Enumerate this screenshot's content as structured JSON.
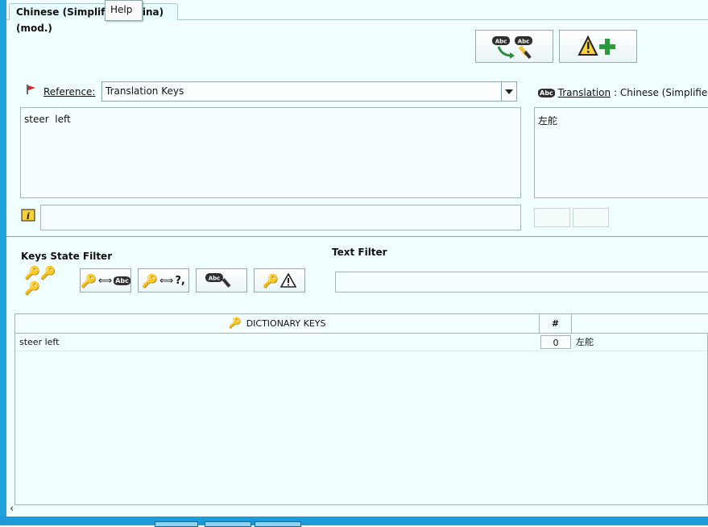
{
  "tabs": {
    "active_tab_label": "Chinese (Simplified, China) (mod.)"
  },
  "menu": {
    "help_label": "Help"
  },
  "reference": {
    "label": "Reference:",
    "selected": "Translation Keys",
    "text": "steer  left"
  },
  "translation": {
    "label_link": "Translation",
    "label_suffix": ": Chinese (Simplified, C",
    "text": "左舵"
  },
  "filters": {
    "keys_state_label": "Keys State Filter",
    "text_filter_label": "Text Filter",
    "text_filter_value": ""
  },
  "table": {
    "columns": [
      "DICTIONARY KEYS",
      "#",
      ""
    ],
    "rows": [
      {
        "key": "steer left",
        "count": "0",
        "translation": "左舵"
      }
    ]
  },
  "icons": {
    "abc_badge": "Abc",
    "question_marks": "?,"
  },
  "colors": {
    "background": "#f2ffff",
    "window_edge": "#1fa3dc"
  }
}
